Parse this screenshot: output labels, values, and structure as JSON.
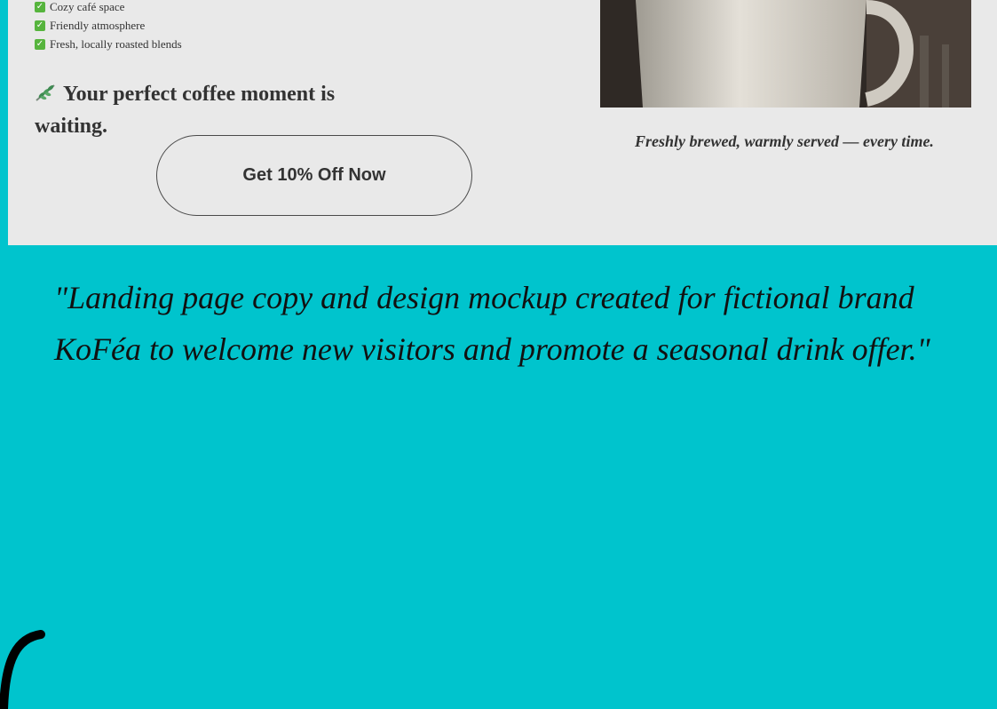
{
  "mockup": {
    "features": [
      "Cozy café space",
      "Friendly atmosphere",
      "Fresh, locally roasted blends"
    ],
    "headline": "Your perfect coffee moment is waiting.",
    "cta_label": "Get 10% Off Now",
    "caption": "Freshly brewed, warmly served — every time."
  },
  "description": "\"Landing page copy and design mockup created for fictional brand KoFéa to welcome new visitors and promote a seasonal drink offer.\"",
  "colors": {
    "background": "#00c4cd",
    "panel": "#e9e9e9",
    "check": "#56b43d"
  },
  "icons": [
    "check-icon",
    "sprig-icon",
    "coffee-cup-photo"
  ]
}
